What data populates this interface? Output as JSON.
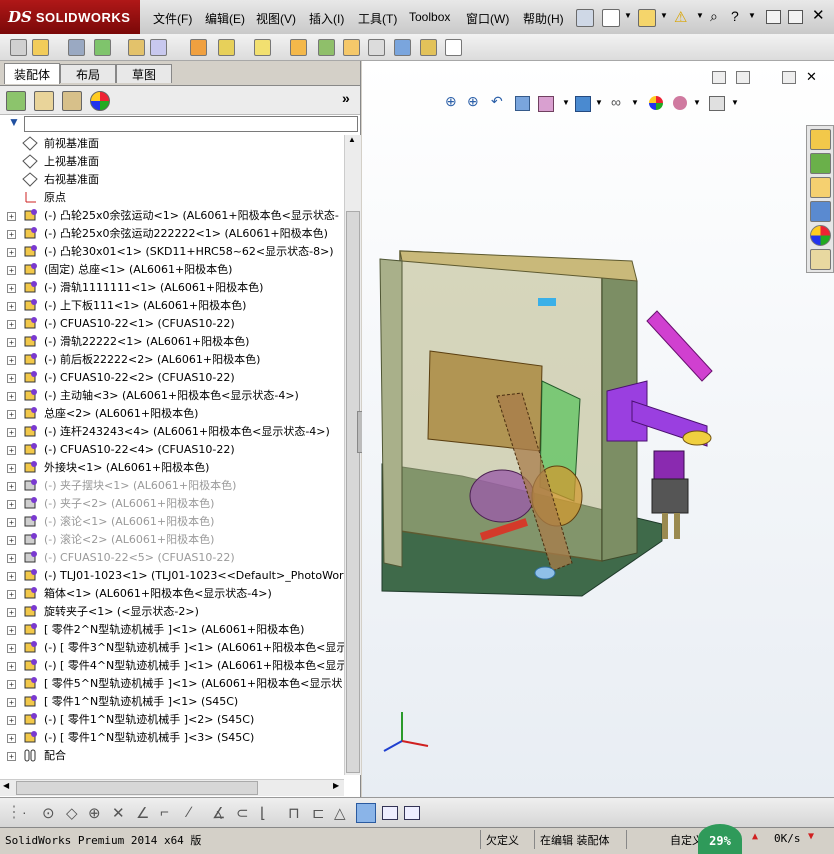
{
  "app": {
    "logo_ds": "DS",
    "logo_name": "SOLIDWORKS"
  },
  "menu": [
    "文件(F)",
    "编辑(E)",
    "视图(V)",
    "插入(I)",
    "工具(T)",
    "Toolbox",
    "窗口(W)",
    "帮助(H)"
  ],
  "panel_tabs": [
    "装配体",
    "布局",
    "草图"
  ],
  "tree": {
    "planes": [
      "前视基准面",
      "上视基准面",
      "右视基准面"
    ],
    "origin": "原点",
    "components": [
      {
        "text": "(-) 凸轮25x0余弦运动<1> (AL6061+阳极本色<显示状态-",
        "suppressed": false
      },
      {
        "text": "(-) 凸轮25x0余弦运动222222<1> (AL6061+阳极本色)",
        "suppressed": false
      },
      {
        "text": "(-) 凸轮30x01<1> (SKD11+HRC58~62<显示状态-8>)",
        "suppressed": false
      },
      {
        "text": "(固定) 总座<1> (AL6061+阳极本色)",
        "suppressed": false
      },
      {
        "text": "(-) 滑轨1111111<1> (AL6061+阳极本色)",
        "suppressed": false
      },
      {
        "text": "(-) 上下板111<1> (AL6061+阳极本色)",
        "suppressed": false
      },
      {
        "text": "(-) CFUAS10-22<1> (CFUAS10-22)",
        "suppressed": false
      },
      {
        "text": "(-) 滑轨22222<1> (AL6061+阳极本色)",
        "suppressed": false
      },
      {
        "text": "(-) 前后板22222<2> (AL6061+阳极本色)",
        "suppressed": false
      },
      {
        "text": "(-) CFUAS10-22<2> (CFUAS10-22)",
        "suppressed": false
      },
      {
        "text": "(-) 主动轴<3> (AL6061+阳极本色<显示状态-4>)",
        "suppressed": false
      },
      {
        "text": "总座<2> (AL6061+阳极本色)",
        "suppressed": false
      },
      {
        "text": "(-) 连杆243243<4> (AL6061+阳极本色<显示状态-4>)",
        "suppressed": false
      },
      {
        "text": "(-) CFUAS10-22<4> (CFUAS10-22)",
        "suppressed": false
      },
      {
        "text": "外接块<1> (AL6061+阳极本色)",
        "suppressed": false
      },
      {
        "text": "(-) 夹子摆块<1> (AL6061+阳极本色)",
        "suppressed": true
      },
      {
        "text": "(-) 夹子<2> (AL6061+阳极本色)",
        "suppressed": true
      },
      {
        "text": "(-) 滚论<1> (AL6061+阳极本色)",
        "suppressed": true
      },
      {
        "text": "(-) 滚论<2> (AL6061+阳极本色)",
        "suppressed": true
      },
      {
        "text": "(-) CFUAS10-22<5> (CFUAS10-22)",
        "suppressed": true
      },
      {
        "text": "(-) TLJ01-1023<1> (TLJ01-1023<<Default>_PhotoWorks",
        "suppressed": false
      },
      {
        "text": "箱体<1> (AL6061+阳极本色<显示状态-4>)",
        "suppressed": false
      },
      {
        "text": "旋转夹子<1> (<显示状态-2>)",
        "suppressed": false
      },
      {
        "text": "[ 零件2^N型轨迹机械手 ]<1> (AL6061+阳极本色)",
        "suppressed": false
      },
      {
        "text": "(-) [ 零件3^N型轨迹机械手 ]<1> (AL6061+阳极本色<显示",
        "suppressed": false
      },
      {
        "text": "(-) [ 零件4^N型轨迹机械手 ]<1> (AL6061+阳极本色<显示",
        "suppressed": false
      },
      {
        "text": "[ 零件5^N型轨迹机械手 ]<1> (AL6061+阳极本色<显示状",
        "suppressed": false
      },
      {
        "text": "[ 零件1^N型轨迹机械手 ]<1> (S45C)",
        "suppressed": false
      },
      {
        "text": "(-) [ 零件1^N型轨迹机械手 ]<2> (S45C)",
        "suppressed": false
      },
      {
        "text": "(-) [ 零件1^N型轨迹机械手 ]<3> (S45C)",
        "suppressed": false
      }
    ],
    "mates": "配合"
  },
  "status": {
    "product": "SolidWorks Premium 2014 x64 版",
    "defined": "欠定义",
    "editing": "在编辑 装配体",
    "custom": "自定义",
    "net_percent": "29%",
    "net_speed": "0K/s"
  },
  "colors": {
    "logo_red": "#a01010",
    "part_green": "#3f6a4a",
    "arm_purple": "#9a3fe0",
    "arm_magenta": "#d040d0"
  }
}
